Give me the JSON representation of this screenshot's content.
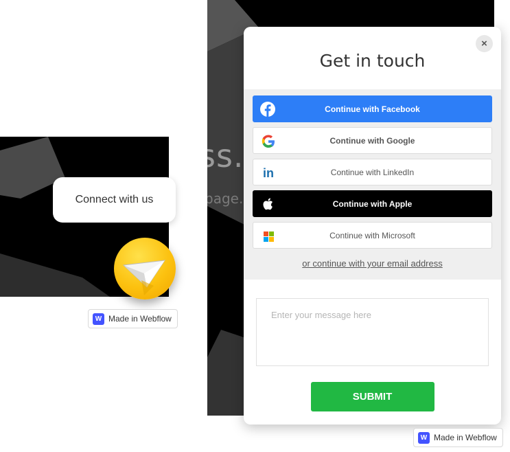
{
  "hero": {
    "title_fragment": "ss.",
    "subtitle_fragment": "page."
  },
  "connect_bubble": {
    "label": "Connect with us"
  },
  "fab": {
    "icon": "paper-plane-icon"
  },
  "webflow_badge": {
    "label": "Made in Webflow",
    "logo_letter": "W"
  },
  "modal": {
    "title": "Get in touch",
    "close_icon": "×",
    "social": {
      "facebook": {
        "label": "Continue with Facebook",
        "icon": "facebook-icon",
        "color": "#2d7ef7"
      },
      "google": {
        "label": "Continue with Google",
        "icon": "google-icon"
      },
      "linkedin": {
        "label": "Continue with LinkedIn",
        "icon": "linkedin-icon",
        "icon_text": "in",
        "color": "#1b6fae"
      },
      "apple": {
        "label": "Continue with Apple",
        "icon": "apple-icon",
        "color": "#000000"
      },
      "microsoft": {
        "label": "Continue with Microsoft",
        "icon": "microsoft-icon"
      }
    },
    "email_link": "or continue with your email address",
    "message_placeholder": "Enter your message here",
    "submit_label": "SUBMIT",
    "submit_color": "#21b843"
  }
}
